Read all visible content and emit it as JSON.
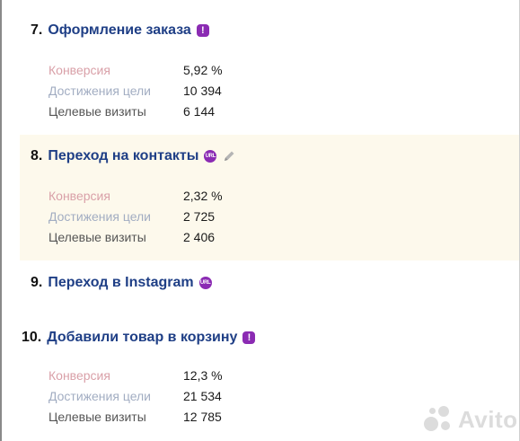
{
  "goals": [
    {
      "num": "7.",
      "name": "Оформление заказа",
      "badge": "!",
      "metrics": [
        {
          "label": "Конверсия",
          "value": "5,92 %"
        },
        {
          "label": "Достижения цели",
          "value": "10 394"
        },
        {
          "label": "Целевые визиты",
          "value": "6 144"
        }
      ]
    },
    {
      "num": "8.",
      "name": "Переход на контакты",
      "badge": "URL",
      "metrics": [
        {
          "label": "Конверсия",
          "value": "2,32 %"
        },
        {
          "label": "Достижения цели",
          "value": "2 725"
        },
        {
          "label": "Целевые визиты",
          "value": "2 406"
        }
      ]
    },
    {
      "num": "9.",
      "name": "Переход в Instagram",
      "badge": "URL"
    },
    {
      "num": "10.",
      "name": "Добавили товар в корзину",
      "badge": "!",
      "metrics": [
        {
          "label": "Конверсия",
          "value": "12,3 %"
        },
        {
          "label": "Достижения цели",
          "value": "21 534"
        },
        {
          "label": "Целевые визиты",
          "value": "12 785"
        }
      ]
    }
  ],
  "watermark": "Avito",
  "icons": {
    "goal_type_badge": "exclamation-icon",
    "url_badge": "url-icon",
    "edit": "pencil-icon"
  },
  "colors": {
    "goal_title": "#1f3f86",
    "badge": "#8b2bb3",
    "highlight": "#fdf9ec"
  }
}
